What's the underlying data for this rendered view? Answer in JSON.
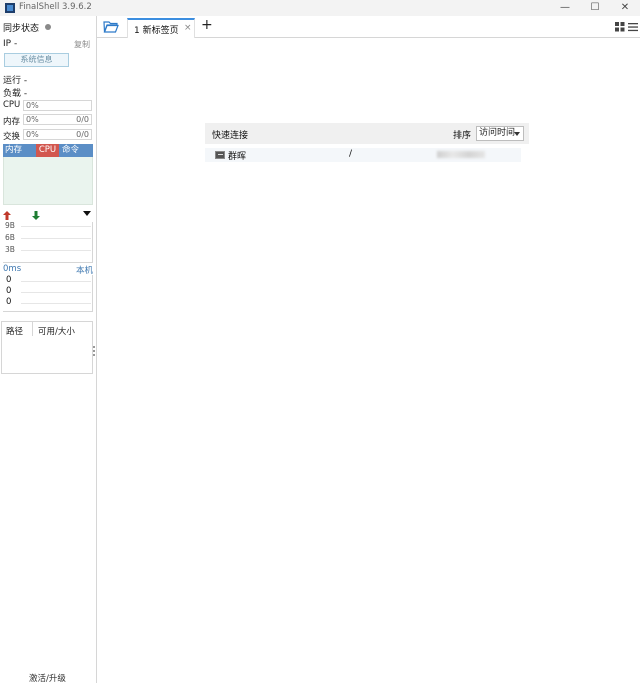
{
  "window": {
    "title": "FinalShell 3.9.6.2",
    "controls": {
      "minimize": "—",
      "maximize": "☐",
      "close": "✕"
    }
  },
  "sidebar": {
    "sync_label": "同步状态",
    "ip_label": "IP -",
    "copy_label": "复制",
    "sysinfo_button": "系统信息",
    "run_label": "运行 -",
    "load_label": "负载 -",
    "stats": [
      {
        "label": "CPU",
        "value": "0%",
        "right": ""
      },
      {
        "label": "内存",
        "value": "0%",
        "right": "0/0"
      },
      {
        "label": "交换",
        "value": "0%",
        "right": "0/0"
      }
    ],
    "process_tabs": {
      "mem": "内存",
      "cpu": "CPU",
      "cmd": "命令"
    },
    "network": {
      "up_icon": "arrow-up-icon",
      "down_icon": "arrow-down-icon",
      "ticks": [
        "9B",
        "6B",
        "3B"
      ]
    },
    "ping": {
      "ms": "0ms",
      "host": "本机",
      "values": [
        "0",
        "0",
        "0"
      ]
    },
    "disk": {
      "col_path": "路径",
      "col_size": "可用/大小"
    },
    "activate_label": "激活/升级"
  },
  "tabbar": {
    "folder_icon": "folder-open-icon",
    "tabs": [
      {
        "label": "1 新标签页",
        "close": "×"
      }
    ],
    "add": "+",
    "layout_icon": "layout-grid-icon",
    "menu_icon": "hamburger-menu-icon"
  },
  "quick_connect": {
    "title": "快速连接",
    "sort_label": "排序",
    "sort_value": "访问时间",
    "connections": [
      {
        "name": "群晖",
        "path": "/"
      }
    ]
  },
  "colors": {
    "accent": "#3c8ee0",
    "process_header": "#5b8ec6",
    "cpu_tab": "#d2574f",
    "up": "#c0392b",
    "down": "#1e7d32"
  }
}
